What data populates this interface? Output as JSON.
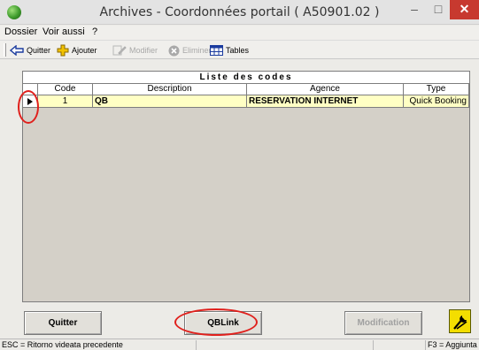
{
  "window": {
    "title": "Archives - Coordonnées portail ( A50901.02 )",
    "minimize_glyph": "–",
    "maximize_glyph": "□",
    "close_glyph": "✕"
  },
  "menu": {
    "items": [
      "Dossier",
      "Voir aussi",
      "?"
    ]
  },
  "toolbar": {
    "quit": "Quitter",
    "add": "Ajouter",
    "modify": "Modifier",
    "delete": "Eliminer",
    "tables": "Tables"
  },
  "grid": {
    "caption": "Liste des codes",
    "columns": [
      "Code",
      "Description",
      "Agence",
      "Type"
    ],
    "rows": [
      {
        "code": "1",
        "description": "QB",
        "agence": "RESERVATION INTERNET",
        "type": "Quick Booking"
      }
    ]
  },
  "buttons": {
    "quit": "Quitter",
    "qblink": "QBLink",
    "modification": "Modification"
  },
  "status": {
    "left": "ESC = Ritorno videata precedente",
    "right": "F3 = Aggiunta"
  },
  "colors": {
    "selected_row": "#ffffc4",
    "annotation": "#e0201c",
    "tool_button": "#f3de00"
  }
}
